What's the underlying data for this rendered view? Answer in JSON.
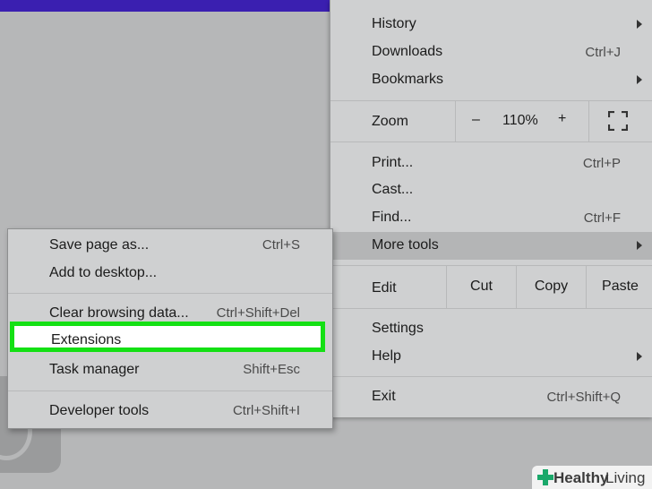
{
  "main_menu": {
    "history": "History",
    "downloads": "Downloads",
    "downloads_shortcut": "Ctrl+J",
    "bookmarks": "Bookmarks",
    "zoom": {
      "label": "Zoom",
      "minus": "–",
      "value": "110%",
      "plus": "+"
    },
    "print": "Print...",
    "print_shortcut": "Ctrl+P",
    "cast": "Cast...",
    "find": "Find...",
    "find_shortcut": "Ctrl+F",
    "more_tools": "More tools",
    "edit": {
      "label": "Edit",
      "cut": "Cut",
      "copy": "Copy",
      "paste": "Paste"
    },
    "settings": "Settings",
    "help": "Help",
    "exit": "Exit",
    "exit_shortcut": "Ctrl+Shift+Q"
  },
  "submenu": {
    "save_page": "Save page as...",
    "save_page_shortcut": "Ctrl+S",
    "add_desktop": "Add to desktop...",
    "clear_data": "Clear browsing data...",
    "clear_data_shortcut": "Ctrl+Shift+Del",
    "extensions": "Extensions",
    "task_manager": "Task manager",
    "task_manager_shortcut": "Shift+Esc",
    "developer_tools": "Developer tools",
    "developer_tools_shortcut": "Ctrl+Shift+I"
  },
  "watermark": {
    "brand_bold": "Healthy",
    "brand_light": "Living"
  },
  "colors": {
    "highlight_border": "#14e014",
    "top_bar": "#3a1fb0",
    "menu_bg": "#cfd0d1"
  }
}
